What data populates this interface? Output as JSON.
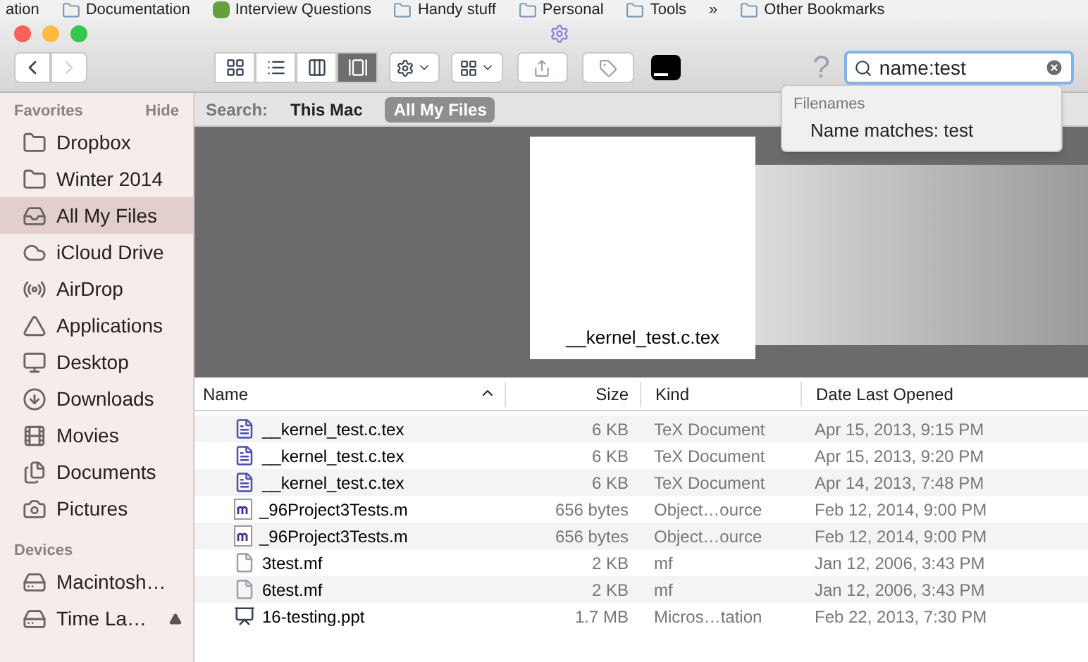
{
  "bookmarks": [
    {
      "label": "ation",
      "kind": "text"
    },
    {
      "label": "Documentation",
      "kind": "folder"
    },
    {
      "label": "Interview Questions",
      "kind": "app"
    },
    {
      "label": "Handy stuff",
      "kind": "folder"
    },
    {
      "label": "Personal",
      "kind": "folder"
    },
    {
      "label": "Tools",
      "kind": "folder"
    },
    {
      "label": "»",
      "kind": "text"
    },
    {
      "label": "Other Bookmarks",
      "kind": "folder"
    }
  ],
  "toolbar": {
    "back_enabled": true,
    "forward_enabled": false,
    "view_modes": [
      {
        "kind": "icons",
        "selected": false
      },
      {
        "kind": "list",
        "selected": false
      },
      {
        "kind": "columns",
        "selected": false
      },
      {
        "kind": "coverflow",
        "selected": true
      }
    ],
    "help": "?"
  },
  "search": {
    "value": "name:test"
  },
  "suggestions": {
    "heading": "Filenames",
    "items": [
      "Name matches: test"
    ]
  },
  "sidebar": [
    {
      "title": "Favorites",
      "action": "Hide",
      "items": [
        {
          "label": "Dropbox",
          "selected": false
        },
        {
          "label": "Winter 2014",
          "selected": false
        },
        {
          "label": "All My Files",
          "selected": true
        },
        {
          "label": "iCloud Drive",
          "selected": false
        },
        {
          "label": "AirDrop",
          "selected": false
        },
        {
          "label": "Applications",
          "selected": false
        },
        {
          "label": "Desktop",
          "selected": false
        },
        {
          "label": "Downloads",
          "selected": false
        },
        {
          "label": "Movies",
          "selected": false
        },
        {
          "label": "Documents",
          "selected": false
        },
        {
          "label": "Pictures",
          "selected": false
        }
      ]
    },
    {
      "title": "Devices",
      "items": [
        {
          "label": "Macintosh…",
          "selected": false,
          "eject": false
        },
        {
          "label": "Time La…",
          "selected": false,
          "eject": true
        }
      ]
    }
  ],
  "scope": {
    "label": "Search:",
    "options": [
      {
        "label": "This Mac",
        "selected": false
      },
      {
        "label": "All My Files",
        "selected": true
      }
    ]
  },
  "preview": {
    "caption": "__kernel_test.c.tex"
  },
  "table": {
    "columns": [
      {
        "label": "Name",
        "sorted": true
      },
      {
        "label": "Size",
        "sorted": false
      },
      {
        "label": "Kind",
        "sorted": false
      },
      {
        "label": "Date Last Opened",
        "sorted": false
      }
    ],
    "rows": [
      {
        "name": "__kernel_test.c.tex",
        "size": "6 KB",
        "kind": "TeX Document",
        "date": "Apr 15, 2013, 9:15 PM"
      },
      {
        "name": "__kernel_test.c.tex",
        "size": "6 KB",
        "kind": "TeX Document",
        "date": "Apr 15, 2013, 9:20 PM"
      },
      {
        "name": "__kernel_test.c.tex",
        "size": "6 KB",
        "kind": "TeX Document",
        "date": "Apr 14, 2013, 7:48 PM"
      },
      {
        "name": "_96Project3Tests.m",
        "size": "656 bytes",
        "kind": "Object…ource",
        "date": "Feb 12, 2014, 9:00 PM"
      },
      {
        "name": "_96Project3Tests.m",
        "size": "656 bytes",
        "kind": "Object…ource",
        "date": "Feb 12, 2014, 9:00 PM"
      },
      {
        "name": "3test.mf",
        "size": "2 KB",
        "kind": "mf",
        "date": "Jan 12, 2006, 3:43 PM"
      },
      {
        "name": "6test.mf",
        "size": "2 KB",
        "kind": "mf",
        "date": "Jan 12, 2006, 3:43 PM"
      },
      {
        "name": "16-testing.ppt",
        "size": "1.7 MB",
        "kind": "Micros…tation",
        "date": "Feb 22, 2013, 7:30 PM"
      }
    ]
  }
}
